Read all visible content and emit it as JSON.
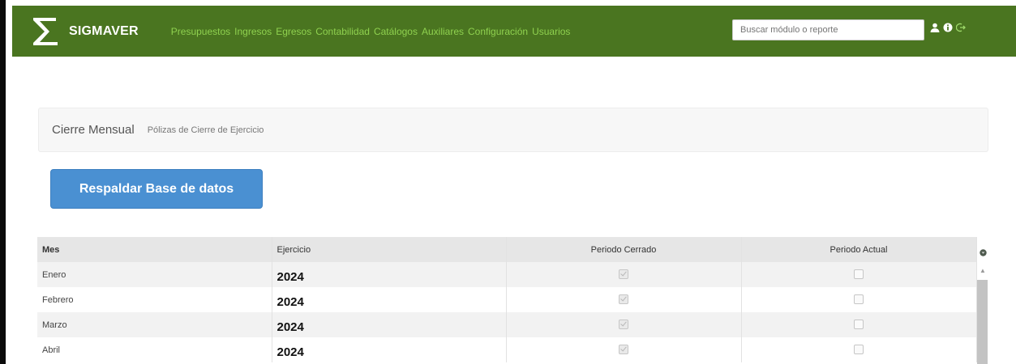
{
  "app": {
    "name": "SIGMAVER"
  },
  "nav": {
    "items": [
      "Presupuestos",
      "Ingresos",
      "Egresos",
      "Contabilidad",
      "Catálogos",
      "Auxiliares",
      "Configuración",
      "Usuarios"
    ],
    "search_placeholder": "Buscar módulo o reporte",
    "icons": [
      "user-icon",
      "info-icon",
      "logout-icon"
    ]
  },
  "breadcrumb": {
    "title": "Cierre Mensual",
    "subtitle": "Pólizas de Cierre de Ejercicio"
  },
  "actions": {
    "backup_label": "Respaldar Base de datos"
  },
  "table": {
    "columns": [
      "Mes",
      "Ejercicio",
      "Periodo Cerrado",
      "Periodo Actual"
    ],
    "rows": [
      {
        "mes": "Enero",
        "ejercicio": "2024",
        "periodo_cerrado": true,
        "periodo_actual": false
      },
      {
        "mes": "Febrero",
        "ejercicio": "2024",
        "periodo_cerrado": true,
        "periodo_actual": false
      },
      {
        "mes": "Marzo",
        "ejercicio": "2024",
        "periodo_cerrado": true,
        "periodo_actual": false
      },
      {
        "mes": "Abril",
        "ejercicio": "2024",
        "periodo_cerrado": true,
        "periodo_actual": false
      }
    ]
  },
  "colors": {
    "navbar": "#4a7520",
    "nav_link": "#8fd14f",
    "button": "#4a90d2"
  }
}
